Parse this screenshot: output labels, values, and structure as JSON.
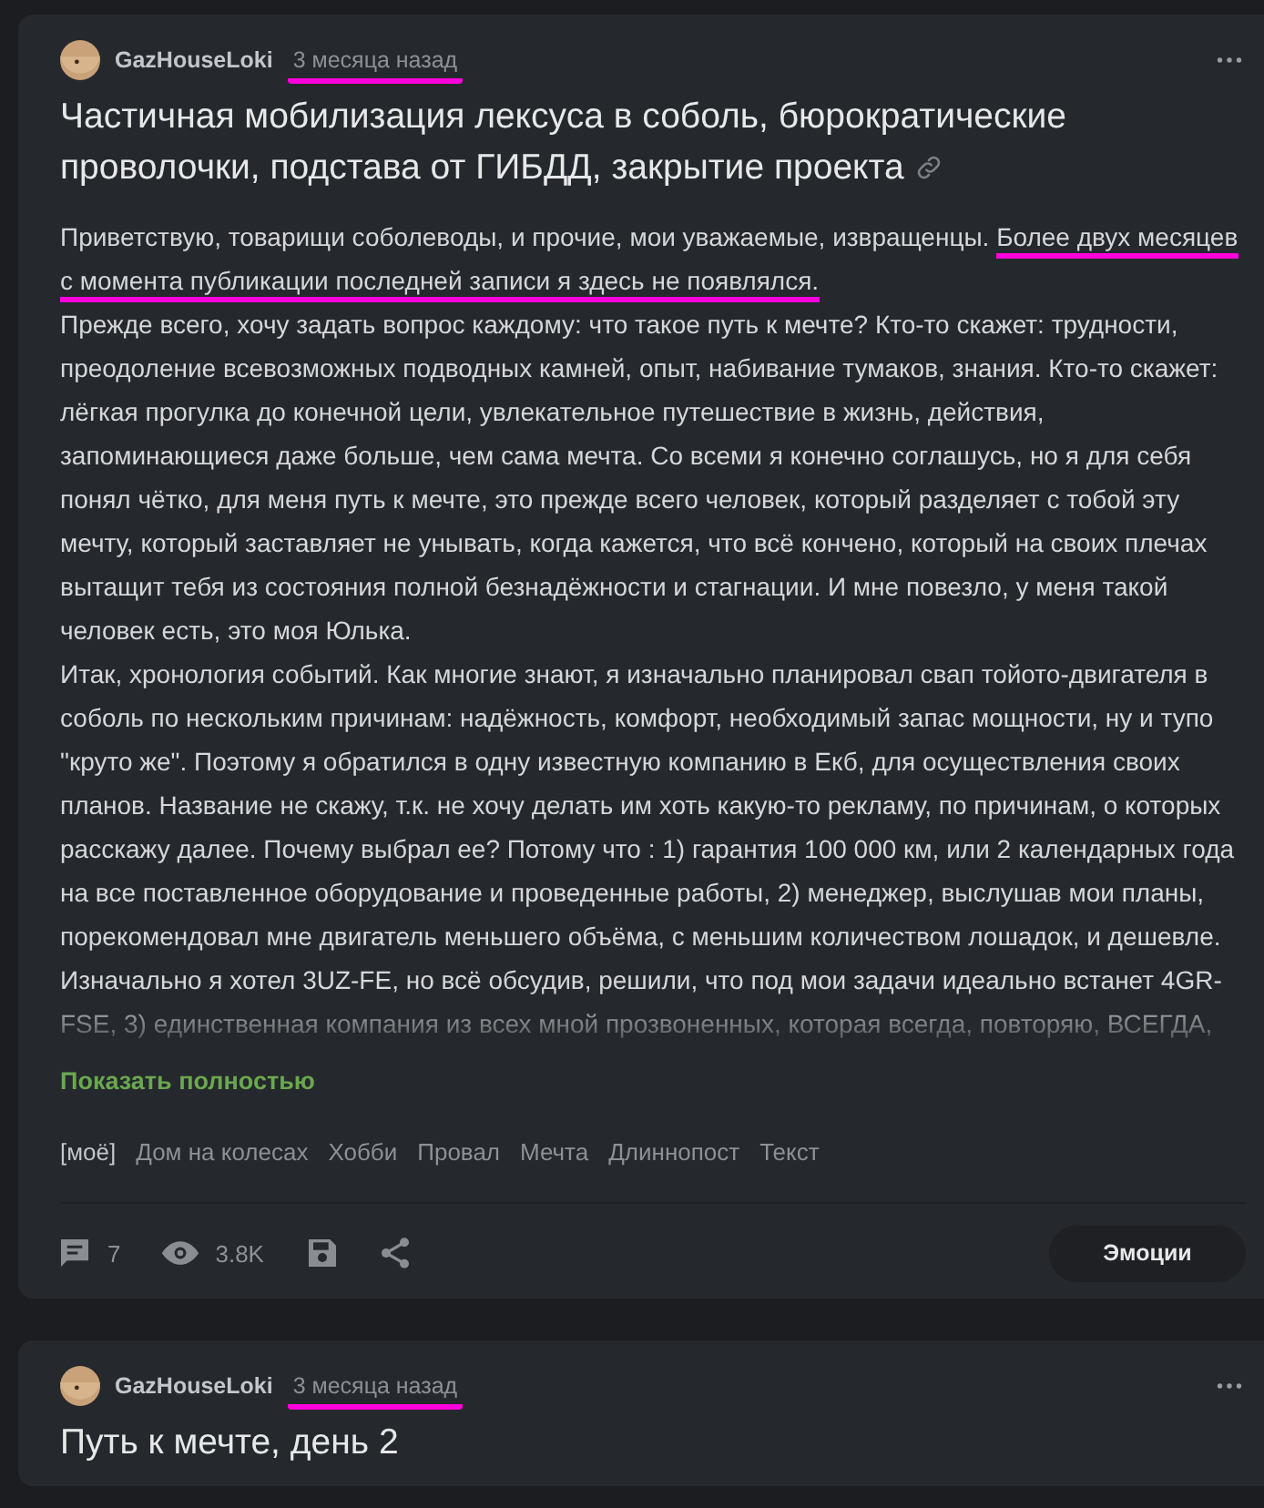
{
  "posts": [
    {
      "author": "GazHouseLoki",
      "time": "3 месяца назад",
      "time_marked": true,
      "title": "Частичная мобилизация лексуса в соболь, бюрократические проволочки, подстава от ГИБДД, закрытие проекта",
      "has_link": true,
      "paragraphs": [
        [
          {
            "text": "Приветствую, товарищи соболеводы, и прочие, мои уважаемые, извращенцы. ",
            "marked": false
          },
          {
            "text": "Более двух месяцев с момента публикации последней записи я здесь не появлялся.",
            "marked": true
          }
        ],
        [
          {
            "text": "Прежде всего, хочу задать вопрос каждому: что такое путь к мечте? Кто-то скажет: трудности, преодоление всевозможных подводных камней, опыт, набивание тумаков, знания. Кто-то скажет: лёгкая прогулка до конечной цели, увлекательное путешествие в жизнь, действия, запоминающиеся даже больше, чем сама мечта. Со всеми я конечно соглашусь, но я для себя понял чётко, для меня путь к мечте, это прежде всего человек, который разделяет с тобой эту мечту, который заставляет не унывать, когда кажется, что всё кончено, который на своих плечах вытащит тебя из состояния полной безнадёжности и стагнации. И мне повезло, у меня такой человек есть, это моя Юлька.",
            "marked": false
          }
        ],
        [
          {
            "text": "Итак, хронология событий. Как многие знают, я изначально планировал свап тойото-двигателя в соболь по нескольким причинам: надёжность, комфорт, необходимый запас мощности, ну и тупо \"круто же\". Поэтому я обратился в одну известную компанию в Екб, для осуществления своих планов. Название не скажу, т.к. не хочу делать им хоть какую-то рекламу, по причинам, о которых расскажу далее. Почему выбрал ее? Потому что : 1) гарантия 100 000 км, или 2 календарных года на все поставленное оборудование и проведенные работы, 2) менеджер, выслушав мои планы, порекомендовал мне двигатель меньшего объёма, с меньшим количеством лошадок, и дешевле. Изначально я хотел 3UZ-FE, но всё обсудив, решили, что под мои задачи идеально встанет 4GR-FSE, 3) единственная компания из всех мной прозвоненных, которая всегда, повторяю, ВСЕГДА,",
            "marked": false
          }
        ]
      ],
      "show_more": "Показать полностью",
      "tags": [
        {
          "label": "[моё]",
          "kind": "own"
        },
        {
          "label": "Дом на колесах",
          "kind": "tag"
        },
        {
          "label": "Хобби",
          "kind": "tag"
        },
        {
          "label": "Провал",
          "kind": "tag"
        },
        {
          "label": "Мечта",
          "kind": "tag"
        },
        {
          "label": "Длиннопост",
          "kind": "tag"
        },
        {
          "label": "Текст",
          "kind": "tag"
        }
      ],
      "comments": "7",
      "views": "3.8K",
      "emotions_button": "Эмоции"
    },
    {
      "author": "GazHouseLoki",
      "time": "3 месяца назад",
      "time_marked": true,
      "title": "Путь к мечте, день 2",
      "has_link": false
    }
  ]
}
